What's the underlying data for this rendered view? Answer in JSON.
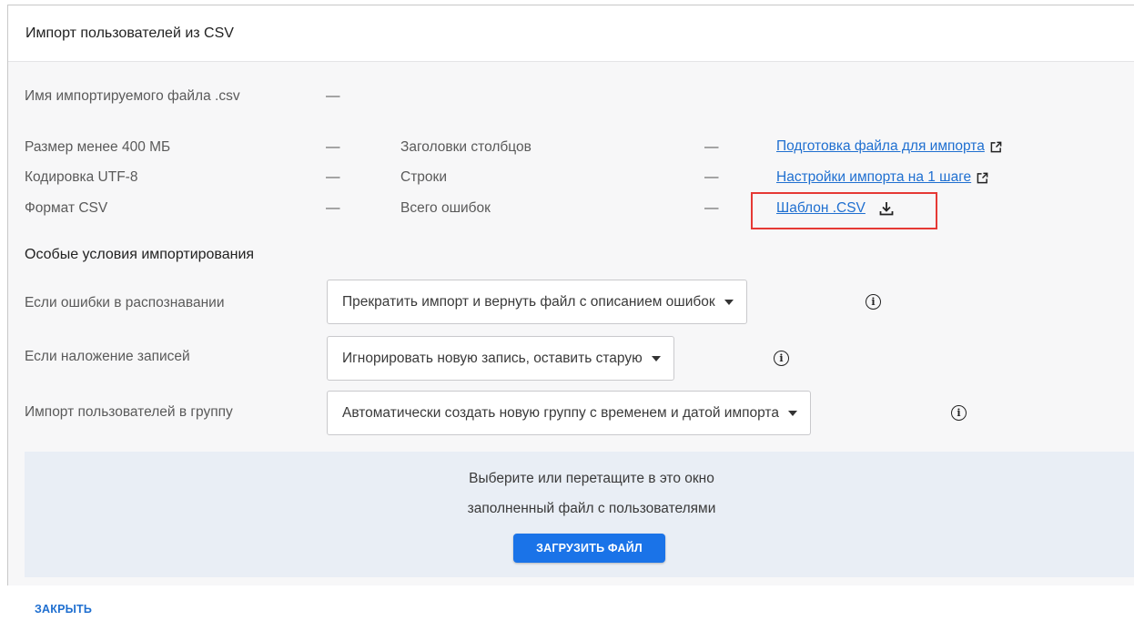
{
  "dialog": {
    "title": "Импорт пользователей из CSV"
  },
  "file_info": {
    "name_label": "Имя импортируемого файла .csv",
    "name_value": "—",
    "checks": [
      {
        "label": "Размер менее 400 МБ",
        "value": "—"
      },
      {
        "label": "Кодировка UTF-8",
        "value": "—"
      },
      {
        "label": "Формат CSV",
        "value": "—"
      }
    ],
    "stats": [
      {
        "label": "Заголовки столбцов",
        "value": "—"
      },
      {
        "label": "Строки",
        "value": "—"
      },
      {
        "label": "Всего ошибок",
        "value": "—"
      }
    ]
  },
  "links": {
    "prepare_file": "Подготовка файла для импорта",
    "import_settings": "Настройки импорта на 1 шаге",
    "template_csv": "Шаблон .CSV"
  },
  "icons": {
    "external": "external-link-icon",
    "download": "download-icon",
    "info": "info-icon"
  },
  "conditions": {
    "title": "Особые условия импортирования",
    "rows": [
      {
        "label": "Если ошибки в распознавании",
        "selected": "Прекратить импорт и вернуть файл с описанием ошибок"
      },
      {
        "label": "Если наложение записей",
        "selected": "Игнорировать новую запись, оставить старую"
      },
      {
        "label": "Импорт пользователей в группу",
        "selected": "Автоматически создать новую группу с временем и датой импорта"
      }
    ]
  },
  "dropzone": {
    "line1": "Выберите или перетащите в это окно",
    "line2": "заполненный файл с пользователями",
    "upload_label": "ЗАГРУЗИТЬ ФАЙЛ"
  },
  "footer": {
    "close_label": "ЗАКРЫТЬ"
  },
  "colors": {
    "link": "#1f6fd0",
    "primary_button": "#1a73e8",
    "highlight": "#e53935",
    "dropzone_bg": "#e9eef5"
  }
}
